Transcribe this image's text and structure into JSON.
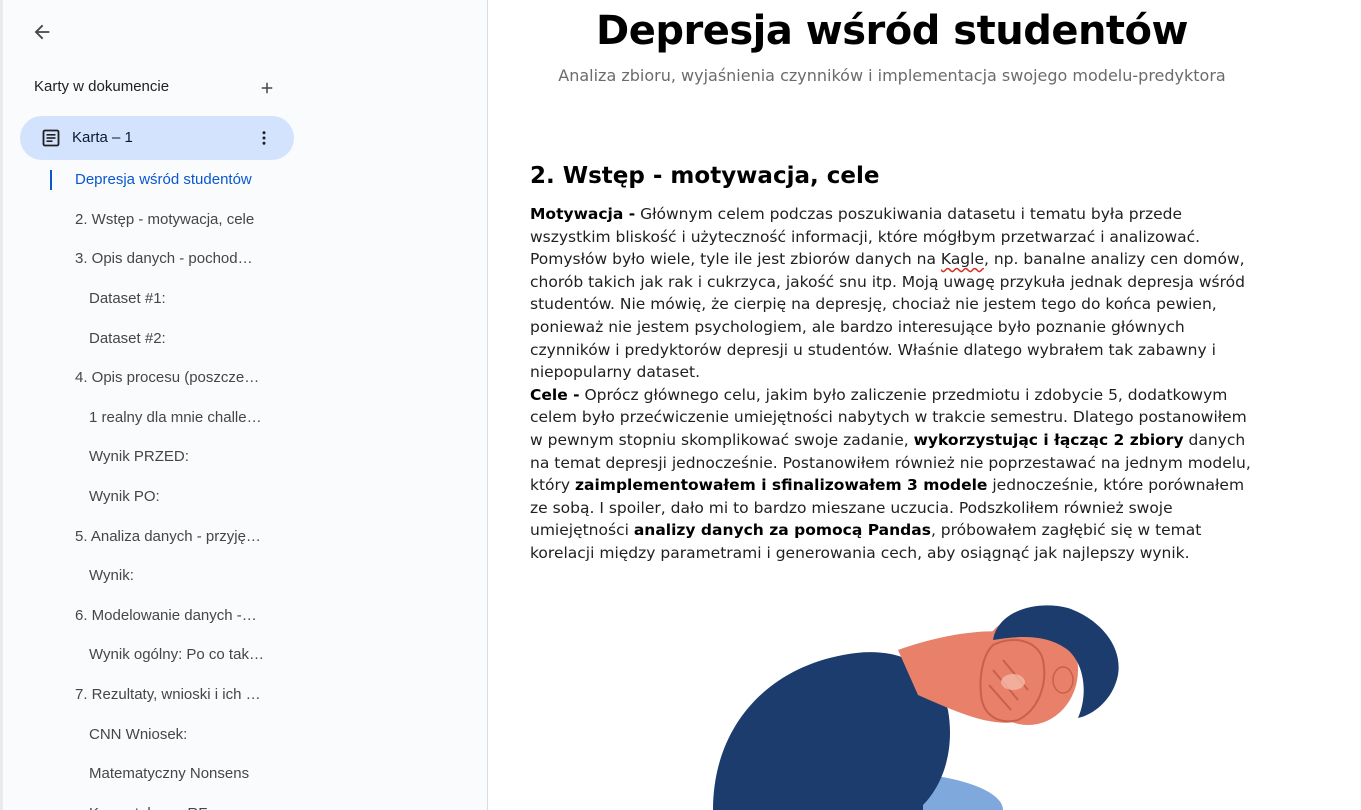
{
  "sidebar": {
    "tabs_header": "Karty w dokumencie",
    "tab": {
      "label": "Karta – 1"
    },
    "outline": [
      {
        "label": "Depresja wśród studentów",
        "level": 1,
        "active": true
      },
      {
        "label": "2. Wstęp - motywacja, cele",
        "level": 1
      },
      {
        "label": "3. Opis danych - pochod…",
        "level": 1
      },
      {
        "label": "Dataset #1:",
        "level": 2
      },
      {
        "label": "Dataset #2:",
        "level": 2
      },
      {
        "label": "4. Opis procesu (poszcze…",
        "level": 1
      },
      {
        "label": "1 realny dla mnie challe…",
        "level": 2
      },
      {
        "label": "Wynik PRZED:",
        "level": 2
      },
      {
        "label": "Wynik PO:",
        "level": 2
      },
      {
        "label": "5. Analiza danych - przyję…",
        "level": 1
      },
      {
        "label": "Wynik:",
        "level": 2
      },
      {
        "label": "6. Modelowanie danych -…",
        "level": 1
      },
      {
        "label": "Wynik ogólny: Po co tak…",
        "level": 2
      },
      {
        "label": "7. Rezultaty, wnioski i ich …",
        "level": 1
      },
      {
        "label": "CNN Wniosek:",
        "level": 2
      },
      {
        "label": "Matematyczny Nonsens",
        "level": 2
      },
      {
        "label": "Korzystałem z RF…",
        "level": 2
      }
    ]
  },
  "doc": {
    "title": "Depresja wśród studentów",
    "subtitle": "Analiza zbioru, wyjaśnienia czynników i implementacja swojego modelu-predyktora",
    "section_heading": "2. Wstęp - motywacja, cele",
    "motywacja": {
      "label": "Motywacja -",
      "text_1": " Głównym celem podczas poszukiwania datasetu i tematu była przede wszystkim bliskość i użyteczność informacji, które mógłbym przetwarzać i analizować. Pomysłów było wiele, tyle ile jest zbiorów danych na ",
      "kagle": "Kagle",
      "text_2": ", np. banalne analizy cen domów, chorób takich jak rak i cukrzyca, jakość snu itp. Moją uwagę przykuła jednak depresja wśród studentów. Nie mówię, że cierpię na depresję, chociaż nie jestem tego do końca pewien, ponieważ nie jestem psychologiem, ale bardzo interesujące było poznanie głównych czynników i predyktorów depresji u studentów. Właśnie dlatego wybrałem tak zabawny i niepopularny dataset."
    },
    "cele": {
      "label": "Cele -",
      "text_1": " Oprócz głównego celu, jakim było zaliczenie przedmiotu i zdobycie 5, dodatkowym celem było przećwiczenie umiejętności nabytych w trakcie semestru. Dlatego postanowiłem w pewnym stopniu skomplikować swoje zadanie, ",
      "bold_1": "wykorzystując i łącząc 2 zbiory",
      "text_2": " danych na temat depresji jednocześnie. Postanowiłem również nie poprzestawać na jednym modelu, który ",
      "bold_2": "zaimplementowałem i sfinalizowałem 3 modele",
      "text_3": " jednocześnie, które porównałem ze sobą. I spoiler, dało mi to bardzo mieszane uczucia. Podszkoliłem również swoje umiejętności ",
      "bold_3": "analizy danych za pomocą Pandas",
      "text_4": ", próbowałem zagłębić się w temat korelacji między parametrami i generowania cech, aby osiągnąć jak najlepszy wynik."
    }
  },
  "icons": {
    "back": "arrow-left-icon",
    "add": "plus-icon",
    "doc": "document-icon",
    "more": "more-vert-icon"
  },
  "colors": {
    "active_tab_bg": "#d3e3fd",
    "active_link": "#0b57d0",
    "skin": "#e8806a",
    "hair": "#1c3c6e",
    "shirt": "#1c3c6e",
    "pants": "#7fa8dc"
  }
}
